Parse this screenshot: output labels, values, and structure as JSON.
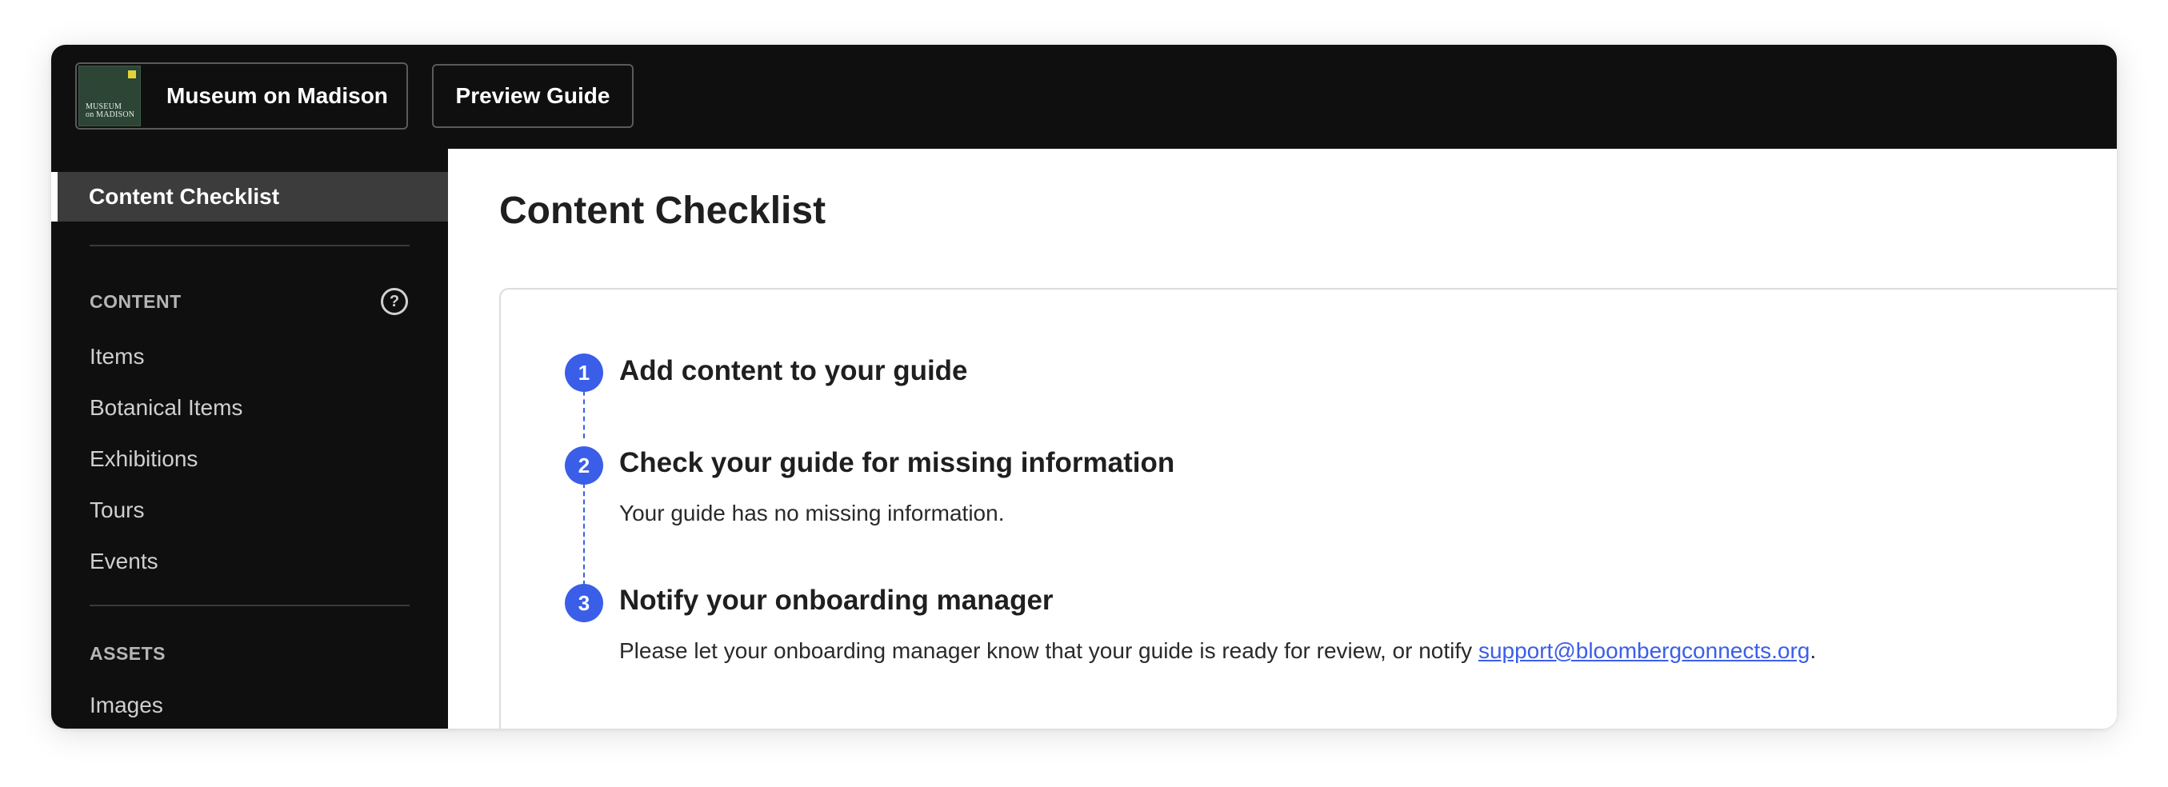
{
  "header": {
    "org_name": "Museum on Madison",
    "org_logo_text": [
      "MUSEUM",
      "on MADISON"
    ],
    "preview_label": "Preview Guide"
  },
  "sidebar": {
    "active_item": "Content Checklist",
    "sections": [
      {
        "label": "CONTENT",
        "help_icon": "question-circle-icon",
        "items": [
          "Items",
          "Botanical Items",
          "Exhibitions",
          "Tours",
          "Events"
        ]
      },
      {
        "label": "ASSETS",
        "items": [
          "Images"
        ]
      }
    ]
  },
  "main": {
    "title": "Content Checklist",
    "steps": [
      {
        "number": "1",
        "title": "Add content to your guide",
        "description": ""
      },
      {
        "number": "2",
        "title": "Check your guide for missing information",
        "description": "Your guide has no missing information."
      },
      {
        "number": "3",
        "title": "Notify your onboarding manager",
        "description_prefix": "Please let your onboarding manager know that your guide is ready for review, or notify ",
        "link": "support@bloombergconnects.org",
        "description_suffix": "."
      }
    ]
  },
  "colors": {
    "topbar_bg": "#0f0f0f",
    "sidebar_active_bg": "#3c3c3c",
    "accent": "#3b5ee9",
    "logo_green": "#2c4535"
  }
}
